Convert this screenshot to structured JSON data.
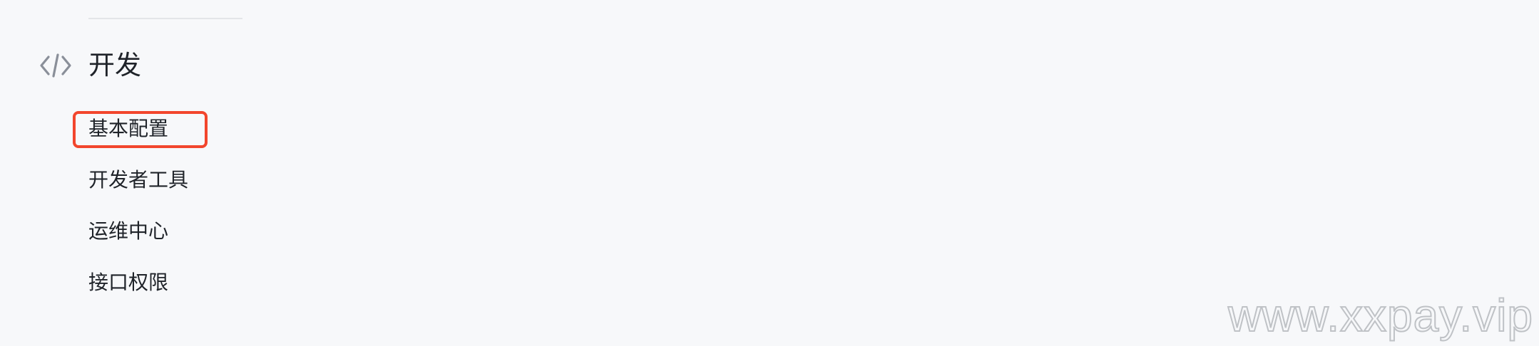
{
  "section": {
    "title": "开发",
    "icon": "code-icon"
  },
  "menu": {
    "items": [
      {
        "label": "基本配置",
        "highlighted": true
      },
      {
        "label": "开发者工具",
        "highlighted": false
      },
      {
        "label": "运维中心",
        "highlighted": false
      },
      {
        "label": "接口权限",
        "highlighted": false
      }
    ]
  },
  "watermark": {
    "text": "www.xxpay.vip"
  },
  "colors": {
    "background": "#f7f8fa",
    "text": "#1f2329",
    "icon": "#8a8f99",
    "highlight_border": "#f2462d",
    "divider": "#e3e5e8"
  }
}
